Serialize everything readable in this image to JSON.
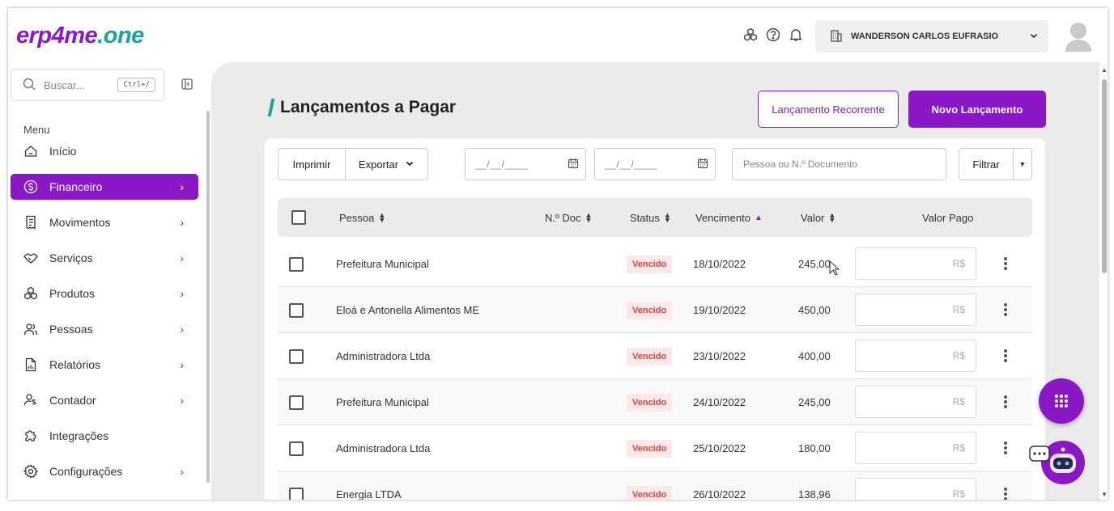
{
  "brand": {
    "part1": "erp4me",
    "part2": ".one"
  },
  "header": {
    "company": "WANDERSON CARLOS EUFRASIO"
  },
  "search": {
    "placeholder": "Buscar...",
    "shortcut": "Ctrl+/"
  },
  "sidebar": {
    "menu_title": "Menu",
    "items": [
      {
        "label": "Início",
        "icon": "home-icon",
        "chevron": false
      },
      {
        "label": "Financeiro",
        "icon": "dollar-icon",
        "chevron": true,
        "active": true
      },
      {
        "label": "Movimentos",
        "icon": "receipt-icon",
        "chevron": true
      },
      {
        "label": "Serviços",
        "icon": "handshake-icon",
        "chevron": true
      },
      {
        "label": "Produtos",
        "icon": "boxes-icon",
        "chevron": true
      },
      {
        "label": "Pessoas",
        "icon": "users-icon",
        "chevron": true
      },
      {
        "label": "Relatórios",
        "icon": "report-icon",
        "chevron": true
      },
      {
        "label": "Contador",
        "icon": "accountant-icon",
        "chevron": true
      },
      {
        "label": "Integrações",
        "icon": "puzzle-icon",
        "chevron": false
      },
      {
        "label": "Configurações",
        "icon": "gear-icon",
        "chevron": true
      }
    ]
  },
  "page": {
    "title": "Lançamentos a Pagar",
    "btn_recurring": "Lançamento Recorrente",
    "btn_new": "Novo Lançamento"
  },
  "toolbar": {
    "print": "Imprimir",
    "export": "Exportar",
    "date_start": "__/__/____",
    "date_end": "__/__/____",
    "person_placeholder": "Pessoa ou N.º Documento",
    "filter": "Filtrar"
  },
  "table": {
    "headers": {
      "pessoa": "Pessoa",
      "ndoc": "N.º Doc",
      "status": "Status",
      "vencimento": "Vencimento",
      "valor": "Valor",
      "valor_pago": "Valor Pago"
    },
    "currency": "R$",
    "rows": [
      {
        "pessoa": "Prefeitura Municipal",
        "ndoc": "",
        "status": "Vencido",
        "vencimento": "18/10/2022",
        "valor": "245,00"
      },
      {
        "pessoa": "Eloá e Antonella Alimentos ME",
        "ndoc": "",
        "status": "Vencido",
        "vencimento": "19/10/2022",
        "valor": "450,00"
      },
      {
        "pessoa": "Administradora Ltda",
        "ndoc": "",
        "status": "Vencido",
        "vencimento": "23/10/2022",
        "valor": "400,00"
      },
      {
        "pessoa": "Prefeitura Municipal",
        "ndoc": "",
        "status": "Vencido",
        "vencimento": "24/10/2022",
        "valor": "245,00"
      },
      {
        "pessoa": "Administradora Ltda",
        "ndoc": "",
        "status": "Vencido",
        "vencimento": "25/10/2022",
        "valor": "180,00"
      },
      {
        "pessoa": "Energia LTDA",
        "ndoc": "",
        "status": "Vencido",
        "vencimento": "26/10/2022",
        "valor": "138,96"
      }
    ]
  },
  "colors": {
    "accent": "#8a18c4",
    "teal": "#1aa39a",
    "overdue": "#e0413b"
  }
}
